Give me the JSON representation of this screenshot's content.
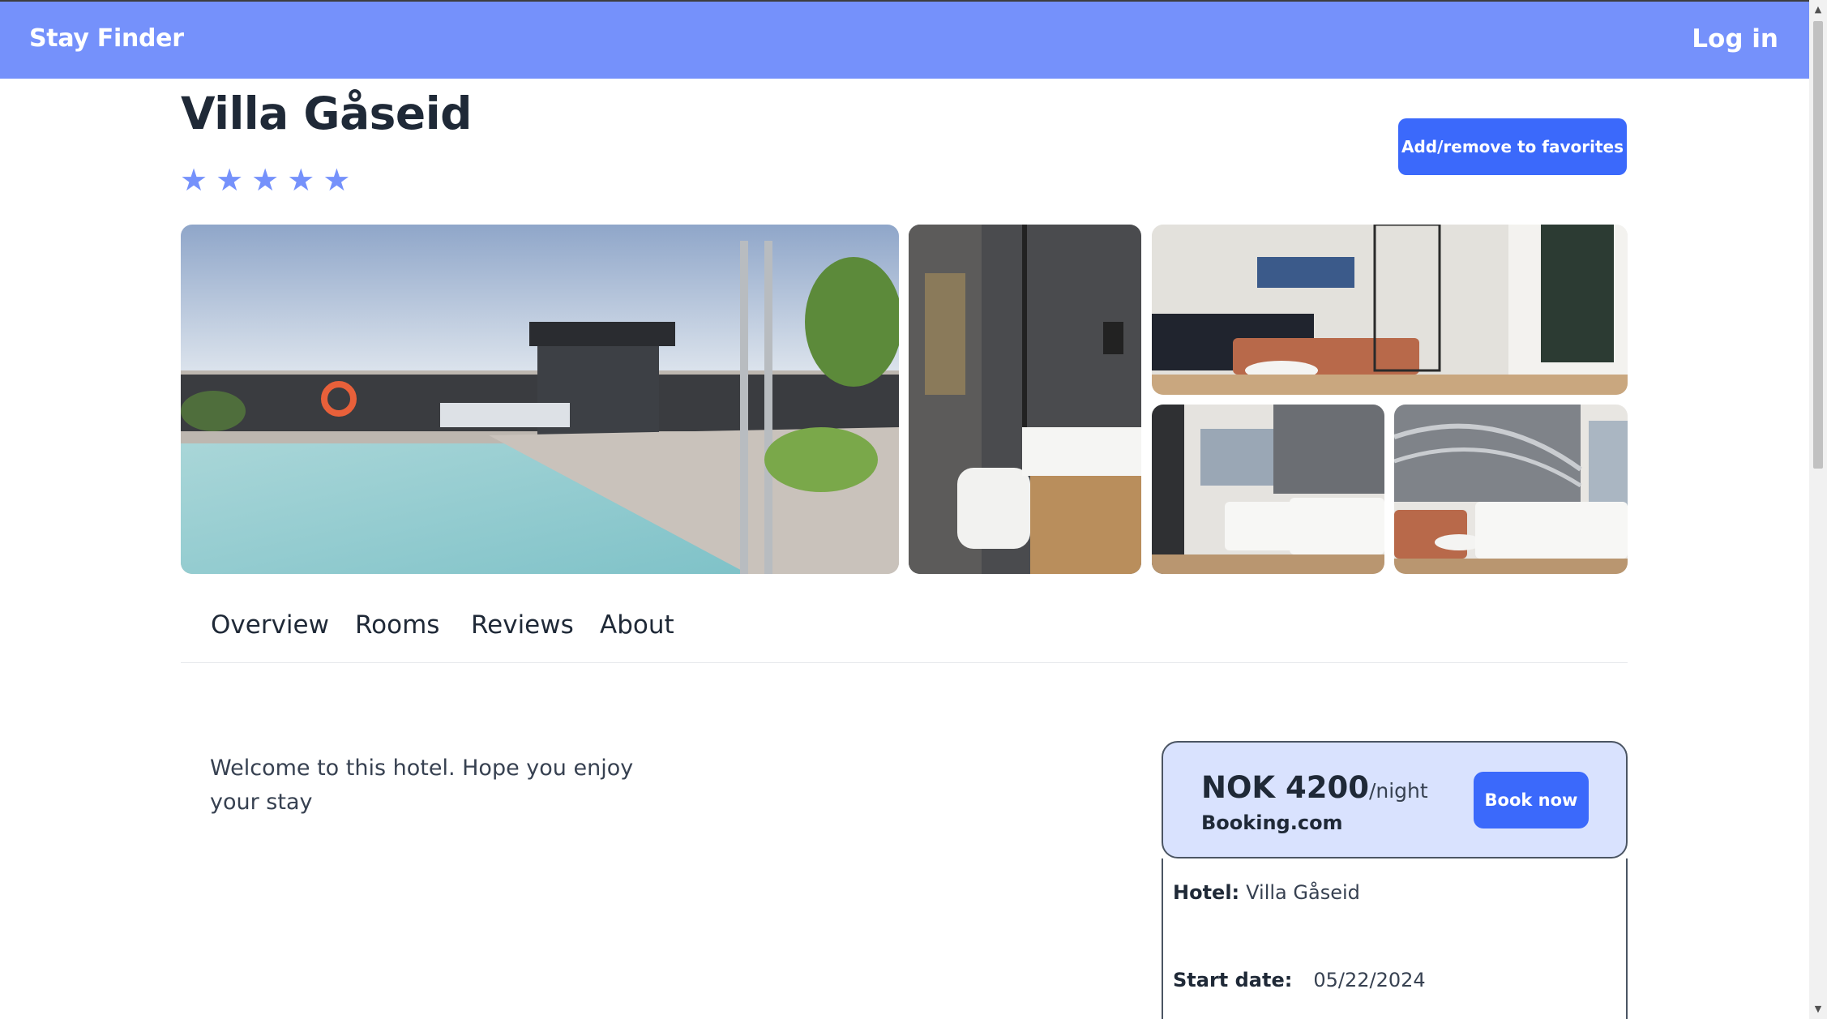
{
  "navbar": {
    "brand": "Stay Finder",
    "login_label": "Log in",
    "color": "#7591fb"
  },
  "hotel": {
    "name": "Villa Gåseid",
    "rating": 5
  },
  "favorites_button": {
    "label": "Add/remove to favorites"
  },
  "gallery": [
    {
      "name": "rooftop-pool"
    },
    {
      "name": "bathroom"
    },
    {
      "name": "lounge"
    },
    {
      "name": "bedroom"
    },
    {
      "name": "bedroom-with-seating"
    }
  ],
  "tabs": [
    {
      "label": "Overview"
    },
    {
      "label": "Rooms"
    },
    {
      "label": "Reviews"
    },
    {
      "label": "About"
    }
  ],
  "description": "Welcome to this hotel. Hope you enjoy your stay",
  "booking": {
    "price": "NOK 4200",
    "per_night": "/night",
    "provider": "Booking.com",
    "book_label": "Book now",
    "hotel_label": "Hotel:",
    "hotel_value": "Villa Gåseid",
    "start_label": "Start date:",
    "start_value": "05/22/2024"
  },
  "colors": {
    "accent": "#3b69fb",
    "star": "#7591fb",
    "card_bg": "#d9e2fe"
  }
}
